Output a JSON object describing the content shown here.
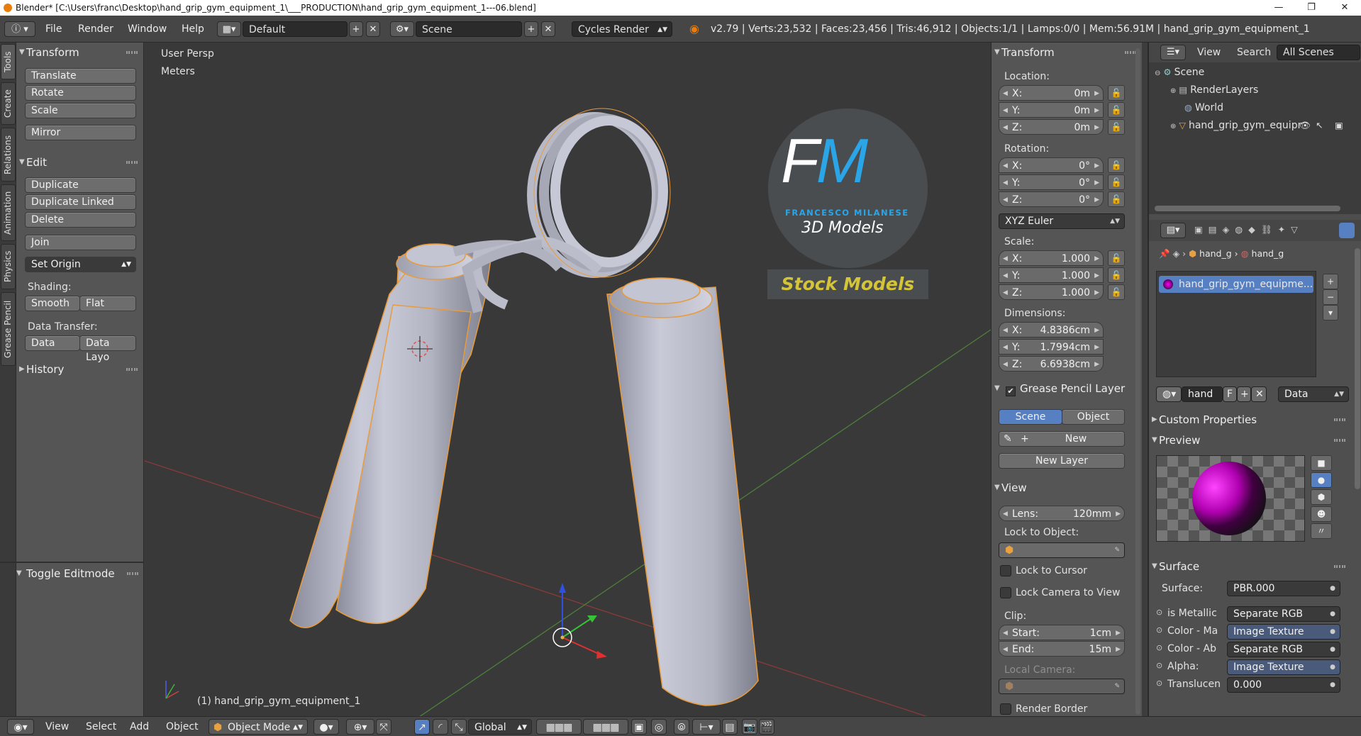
{
  "window": {
    "title": "Blender* [C:\\Users\\franc\\Desktop\\hand_grip_gym_equipment_1\\___PRODUCTION\\hand_grip_gym_equipment_1---06.blend]"
  },
  "topbar": {
    "menus": [
      "File",
      "Render",
      "Window",
      "Help"
    ],
    "layout": "Default",
    "scene": "Scene",
    "engine": "Cycles Render",
    "stats": "v2.79 | Verts:23,532 | Faces:23,456 | Tris:46,912 | Objects:1/1 | Lamps:0/0 | Mem:56.91M | hand_grip_gym_equipment_1"
  },
  "tabs": [
    "Tools",
    "Create",
    "Relations",
    "Animation",
    "Physics",
    "Grease Pencil"
  ],
  "toolshelf": {
    "transform_header": "Transform",
    "translate": "Translate",
    "rotate": "Rotate",
    "scale": "Scale",
    "mirror": "Mirror",
    "edit_header": "Edit",
    "duplicate": "Duplicate",
    "duplicate_linked": "Duplicate Linked",
    "delete": "Delete",
    "join": "Join",
    "set_origin": "Set Origin",
    "shading_label": "Shading:",
    "smooth": "Smooth",
    "flat": "Flat",
    "data_transfer_label": "Data Transfer:",
    "data": "Data",
    "data_layo": "Data Layo",
    "history": "History",
    "toggle_editmode": "Toggle Editmode"
  },
  "viewport": {
    "view_name": "User Persp",
    "units": "Meters",
    "object_label": "(1) hand_grip_gym_equipment_1",
    "logo_letters": "FM",
    "logo_name": "FRANCESCO MILANESE",
    "logo_sub": "3D Models",
    "logo_badge": "Stock Models"
  },
  "npanel": {
    "transform_header": "Transform",
    "location_label": "Location:",
    "location": [
      {
        "axis": "X:",
        "value": "0m"
      },
      {
        "axis": "Y:",
        "value": "0m"
      },
      {
        "axis": "Z:",
        "value": "0m"
      }
    ],
    "rotation_label": "Rotation:",
    "rotation": [
      {
        "axis": "X:",
        "value": "0°"
      },
      {
        "axis": "Y:",
        "value": "0°"
      },
      {
        "axis": "Z:",
        "value": "0°"
      }
    ],
    "rotation_mode": "XYZ Euler",
    "scale_label": "Scale:",
    "scale": [
      {
        "axis": "X:",
        "value": "1.000"
      },
      {
        "axis": "Y:",
        "value": "1.000"
      },
      {
        "axis": "Z:",
        "value": "1.000"
      }
    ],
    "dimensions_label": "Dimensions:",
    "dimensions": [
      {
        "axis": "X:",
        "value": "4.8386cm"
      },
      {
        "axis": "Y:",
        "value": "1.7994cm"
      },
      {
        "axis": "Z:",
        "value": "6.6938cm"
      }
    ],
    "gp_header": "Grease Pencil Layer",
    "gp_scene": "Scene",
    "gp_object": "Object",
    "gp_new": "New",
    "gp_new_layer": "New Layer",
    "view_header": "View",
    "lens_label": "Lens:",
    "lens_value": "120mm",
    "lock_to_object": "Lock to Object:",
    "lock_to_cursor": "Lock to Cursor",
    "lock_camera": "Lock Camera to View",
    "clip_label": "Clip:",
    "clip_start_label": "Start:",
    "clip_start": "1cm",
    "clip_end_label": "End:",
    "clip_end": "15m",
    "local_camera": "Local Camera:",
    "render_border": "Render Border"
  },
  "outliner": {
    "view": "View",
    "search": "Search",
    "all_scenes": "All Scenes",
    "items": [
      "Scene",
      "RenderLayers",
      "World",
      "hand_grip_gym_equipr"
    ]
  },
  "properties": {
    "breadcrumb_obj": "hand_g",
    "breadcrumb_mat": "hand_g",
    "material_slot": "hand_grip_gym_equipme...",
    "mat_name": "hand",
    "mat_f": "F",
    "mat_link": "Data",
    "custom_props": "Custom Properties",
    "preview": "Preview",
    "surface_header": "Surface",
    "surface_label": "Surface:",
    "surface_value": "PBR.000",
    "inputs": [
      {
        "label": "is Metallic",
        "value": "Separate RGB"
      },
      {
        "label": "Color - Ma",
        "value": "Image Texture"
      },
      {
        "label": "Color - Ab",
        "value": "Separate RGB"
      },
      {
        "label": "Alpha:",
        "value": "Image Texture"
      },
      {
        "label": "Translucen",
        "value": "0.000"
      }
    ]
  },
  "bottombar": {
    "view": "View",
    "select": "Select",
    "add": "Add",
    "object": "Object",
    "mode": "Object Mode",
    "orientation": "Global"
  },
  "colors": {
    "selected_blue": "#5680c2",
    "outline_orange": "#e89b3c"
  }
}
